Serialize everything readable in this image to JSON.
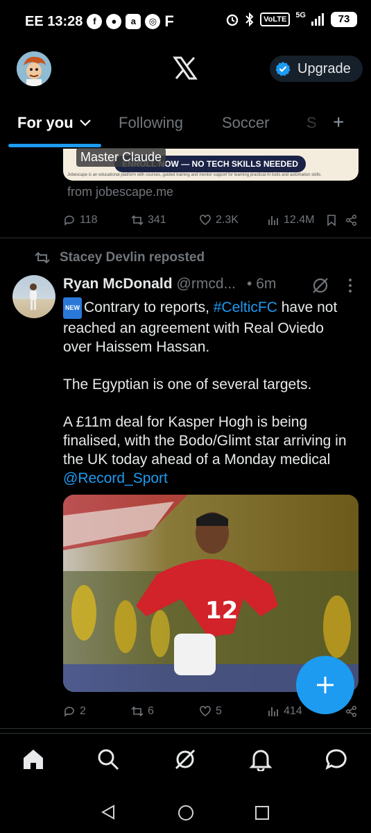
{
  "status_bar": {
    "carrier_time": "EE 13:28",
    "left_icons": [
      "facebook-icon",
      "messenger-icon",
      "app-icon",
      "chrome-icon",
      "f-icon"
    ],
    "left_icon_glyphs": [
      "f",
      "●",
      "a",
      "◎",
      "F"
    ],
    "volte": "VoLTE",
    "network": "5G",
    "battery": "73"
  },
  "header": {
    "upgrade_label": "Upgrade"
  },
  "tabs": [
    {
      "label": "For you",
      "active": true
    },
    {
      "label": "Following",
      "active": false
    },
    {
      "label": "Soccer",
      "active": false
    },
    {
      "label": "S",
      "active": false
    }
  ],
  "ad": {
    "caption": "Master Claude",
    "enroll": "ENROLL NOW — NO TECH SKILLS NEEDED",
    "fine_print": "Jobescape is an educational platform with courses, guided training and mentor support for learning practical AI tools and automation skills.",
    "source": "from jobescape.me",
    "replies": "118",
    "reposts": "341",
    "likes": "2.3K",
    "views": "12.4M"
  },
  "tweet": {
    "reposted_by": "Stacey Devlin reposted",
    "name": "Ryan McDonald",
    "handle": "@rmcd...",
    "time": "• 6m",
    "badge": "NEW",
    "text_1a": "Contrary to reports, ",
    "hashtag": "#CelticFC",
    "text_1b": " have not reached an agreement with Real Oviedo over Haissem Hassan.",
    "text_2": "The Egyptian is one of several targets.",
    "text_3": "A £11m deal for Kasper Hogh is being finalised, with the Bodo/Glimt star arriving in the UK today ahead of a Monday medical ",
    "mention": "@Record_Sport",
    "jersey_number": "12",
    "replies": "2",
    "reposts": "6",
    "likes": "5",
    "views": "414"
  },
  "colors": {
    "accent": "#1d9bf0",
    "muted": "#71767b",
    "text": "#e7e9ea",
    "background": "#000000"
  }
}
